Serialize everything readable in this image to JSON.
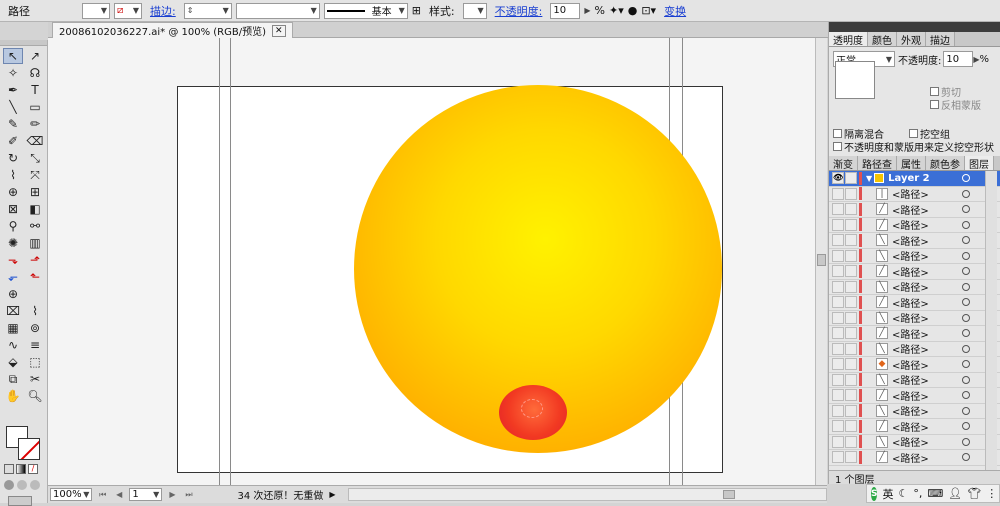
{
  "control_bar": {
    "object_type": "路径",
    "stroke_label": "描边:",
    "opacity_label": "不透明度:",
    "opacity_value": "10",
    "percent": "%",
    "transform_label": "变换",
    "style_label": "样式:",
    "basic_label": "基本"
  },
  "document": {
    "tab_title": "20086102036227.ai* @ 100% (RGB/预览)"
  },
  "status": {
    "zoom": "100%",
    "page": "1",
    "info": "34 次还原！无重做"
  },
  "transparency_panel": {
    "tabs": [
      "透明度",
      "颜色",
      "外观",
      "描边"
    ],
    "blend_mode": "正常",
    "opacity_label": "不透明度:",
    "opacity_value": "10",
    "percent": "%",
    "clip_label": "剪切",
    "invert_mask_label": "反相蒙版",
    "isolate_blend_label": "隔离混合",
    "knockout_group_label": "挖空组",
    "opacity_mask_label": "不透明度和蒙版用来定义挖空形状"
  },
  "layers_panel": {
    "tabs": [
      "渐变",
      "路径查",
      "属性",
      "颜色参",
      "图层"
    ],
    "layer_name": "Layer 2",
    "item_label": "<路径>",
    "footer": "1 个图层"
  },
  "ime": {
    "lang": "英"
  }
}
